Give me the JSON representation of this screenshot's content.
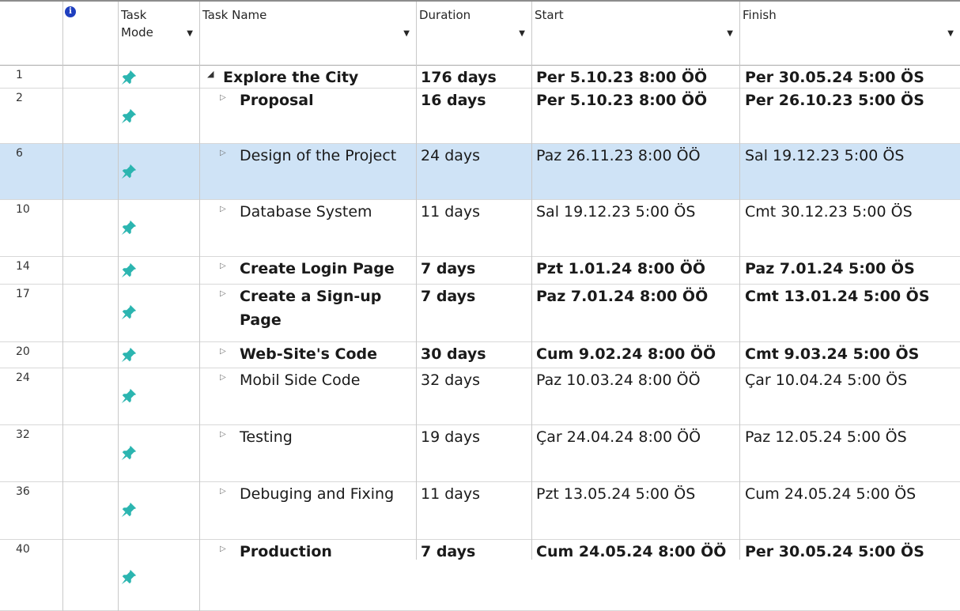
{
  "headers": {
    "indicators_icon": "info-icon",
    "task_mode_line1": "Task",
    "task_mode_line2": "Mode",
    "task_name": "Task Name",
    "duration": "Duration",
    "start": "Start",
    "finish": "Finish"
  },
  "colors": {
    "selected_row": "#cfe3f6",
    "pin_icon": "#2bb5b0",
    "info_icon": "#1f3fbf"
  },
  "rows": [
    {
      "id": "1",
      "name": "Explore the City",
      "duration": "176 days",
      "start": "Per 5.10.23 8:00 ÖÖ",
      "finish": "Per 30.05.24 5:00 ÖS",
      "bold": true,
      "expand": "open"
    },
    {
      "id": "2",
      "name": "Proposal",
      "duration": "16 days",
      "start": "Per 5.10.23 8:00 ÖÖ",
      "finish": "Per 26.10.23 5:00 ÖS",
      "bold": true,
      "expand": "closed"
    },
    {
      "id": "6",
      "name": "Design of the Project",
      "duration": "24 days",
      "start": "Paz 26.11.23 8:00 ÖÖ",
      "finish": "Sal 19.12.23 5:00 ÖS",
      "bold": false,
      "expand": "closed",
      "selected": true
    },
    {
      "id": "10",
      "name": "Database System",
      "duration": "11 days",
      "start": "Sal 19.12.23 5:00 ÖS",
      "finish": "Cmt 30.12.23 5:00 ÖS",
      "bold": false,
      "expand": "closed"
    },
    {
      "id": "14",
      "name": "Create Login Page",
      "duration": "7 days",
      "start": "Pzt 1.01.24 8:00 ÖÖ",
      "finish": "Paz 7.01.24 5:00 ÖS",
      "bold": true,
      "expand": "closed"
    },
    {
      "id": "17",
      "name": "Create a Sign-up Page",
      "duration": "7 days",
      "start": "Paz 7.01.24 8:00 ÖÖ",
      "finish": "Cmt 13.01.24 5:00 ÖS",
      "bold": true,
      "expand": "closed"
    },
    {
      "id": "20",
      "name": "Web-Site's Code",
      "duration": "30 days",
      "start": "Cum 9.02.24 8:00 ÖÖ",
      "finish": "Cmt 9.03.24 5:00 ÖS",
      "bold": true,
      "expand": "closed"
    },
    {
      "id": "24",
      "name": "Mobil Side Code",
      "duration": "32 days",
      "start": "Paz 10.03.24 8:00 ÖÖ",
      "finish": "Çar 10.04.24 5:00 ÖS",
      "bold": false,
      "expand": "closed"
    },
    {
      "id": "32",
      "name": "Testing",
      "duration": "19 days",
      "start": "Çar 24.04.24 8:00 ÖÖ",
      "finish": "Paz 12.05.24 5:00 ÖS",
      "bold": false,
      "expand": "closed"
    },
    {
      "id": "36",
      "name": "Debuging and Fixing",
      "duration": "11 days",
      "start": "Pzt 13.05.24 5:00 ÖS",
      "finish": "Cum 24.05.24 5:00 ÖS",
      "bold": false,
      "expand": "closed"
    },
    {
      "id": "40",
      "name": "Production",
      "duration": "7 days",
      "start": "Cum 24.05.24 8:00 ÖÖ",
      "finish": "Per 30.05.24 5:00 ÖS",
      "bold": true,
      "expand": "closed"
    }
  ]
}
